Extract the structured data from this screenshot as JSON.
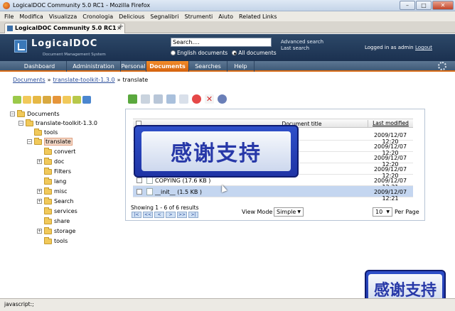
{
  "window": {
    "title": "LogicalDOC Community 5.0 RC1 - Mozilla Firefox"
  },
  "menubar": [
    "File",
    "Modifica",
    "Visualizza",
    "Cronologia",
    "Delicious",
    "Segnalibri",
    "Strumenti",
    "Aiuto",
    "Related Links"
  ],
  "browser_tab": {
    "title": "LogicalDOC Community 5.0 RC1"
  },
  "app": {
    "logo_name": "LogicalDOC",
    "logo_sub": "Document Management System",
    "search_value": "Search....",
    "search_scope": {
      "option1": "English documents",
      "option2": "All documents",
      "selected": "All documents"
    },
    "advanced_search": "Advanced search",
    "last_search": "Last search",
    "logged_in": "Logged in as admin",
    "logout": "Logout"
  },
  "nav": {
    "tabs": [
      "Dashboard",
      "Administration",
      "Personal",
      "Documents",
      "Searches",
      "Help"
    ],
    "active": "Documents"
  },
  "breadcrumb": {
    "root": "Documents",
    "mid": "translate-toolkit-1.3.0",
    "current": "translate",
    "sep": "»"
  },
  "tree": [
    {
      "label": "Documents",
      "expander": "−"
    },
    {
      "label": "translate-toolkit-1.3.0",
      "expander": "−"
    },
    {
      "label": "tools",
      "expander": ""
    },
    {
      "label": "translate",
      "expander": "−",
      "selected": true
    },
    {
      "label": "convert",
      "expander": ""
    },
    {
      "label": "doc",
      "expander": "+"
    },
    {
      "label": "Filters",
      "expander": ""
    },
    {
      "label": "lang",
      "expander": ""
    },
    {
      "label": "misc",
      "expander": "+"
    },
    {
      "label": "Search",
      "expander": "+"
    },
    {
      "label": "services",
      "expander": ""
    },
    {
      "label": "share",
      "expander": ""
    },
    {
      "label": "storage",
      "expander": "+"
    },
    {
      "label": "tools",
      "expander": ""
    }
  ],
  "grid": {
    "col_title": "Document title",
    "col_modified": "Last modified",
    "rows": [
      {
        "title": "",
        "date": "2009/12/07 12:20"
      },
      {
        "title": "",
        "date": "2009/12/07 12:20"
      },
      {
        "title": "",
        "date": "2009/12/07 12:20"
      },
      {
        "title": "",
        "date": "2009/12/07 12:20"
      },
      {
        "title": "COPYING  (17.6 KB )",
        "date": "2009/12/07 12:21"
      },
      {
        "title": "__init__  (1.5 KB )",
        "date": "2009/12/07 12:21",
        "selected": true
      }
    ],
    "showing": "Showing 1 - 6 of 6 results",
    "pager": [
      "|<",
      "<<",
      "<",
      ">",
      ">>",
      ">|"
    ],
    "view_mode_label": "View Mode",
    "view_mode_value": "Simple",
    "per_page_value": "10",
    "per_page_label": "Per Page"
  },
  "overlay_text": "感谢支持",
  "status": {
    "text": "javascript:;"
  },
  "colors": {
    "accent_orange": "#e0781c",
    "header_navy": "#24405f",
    "link_blue": "#2a4d9a"
  }
}
